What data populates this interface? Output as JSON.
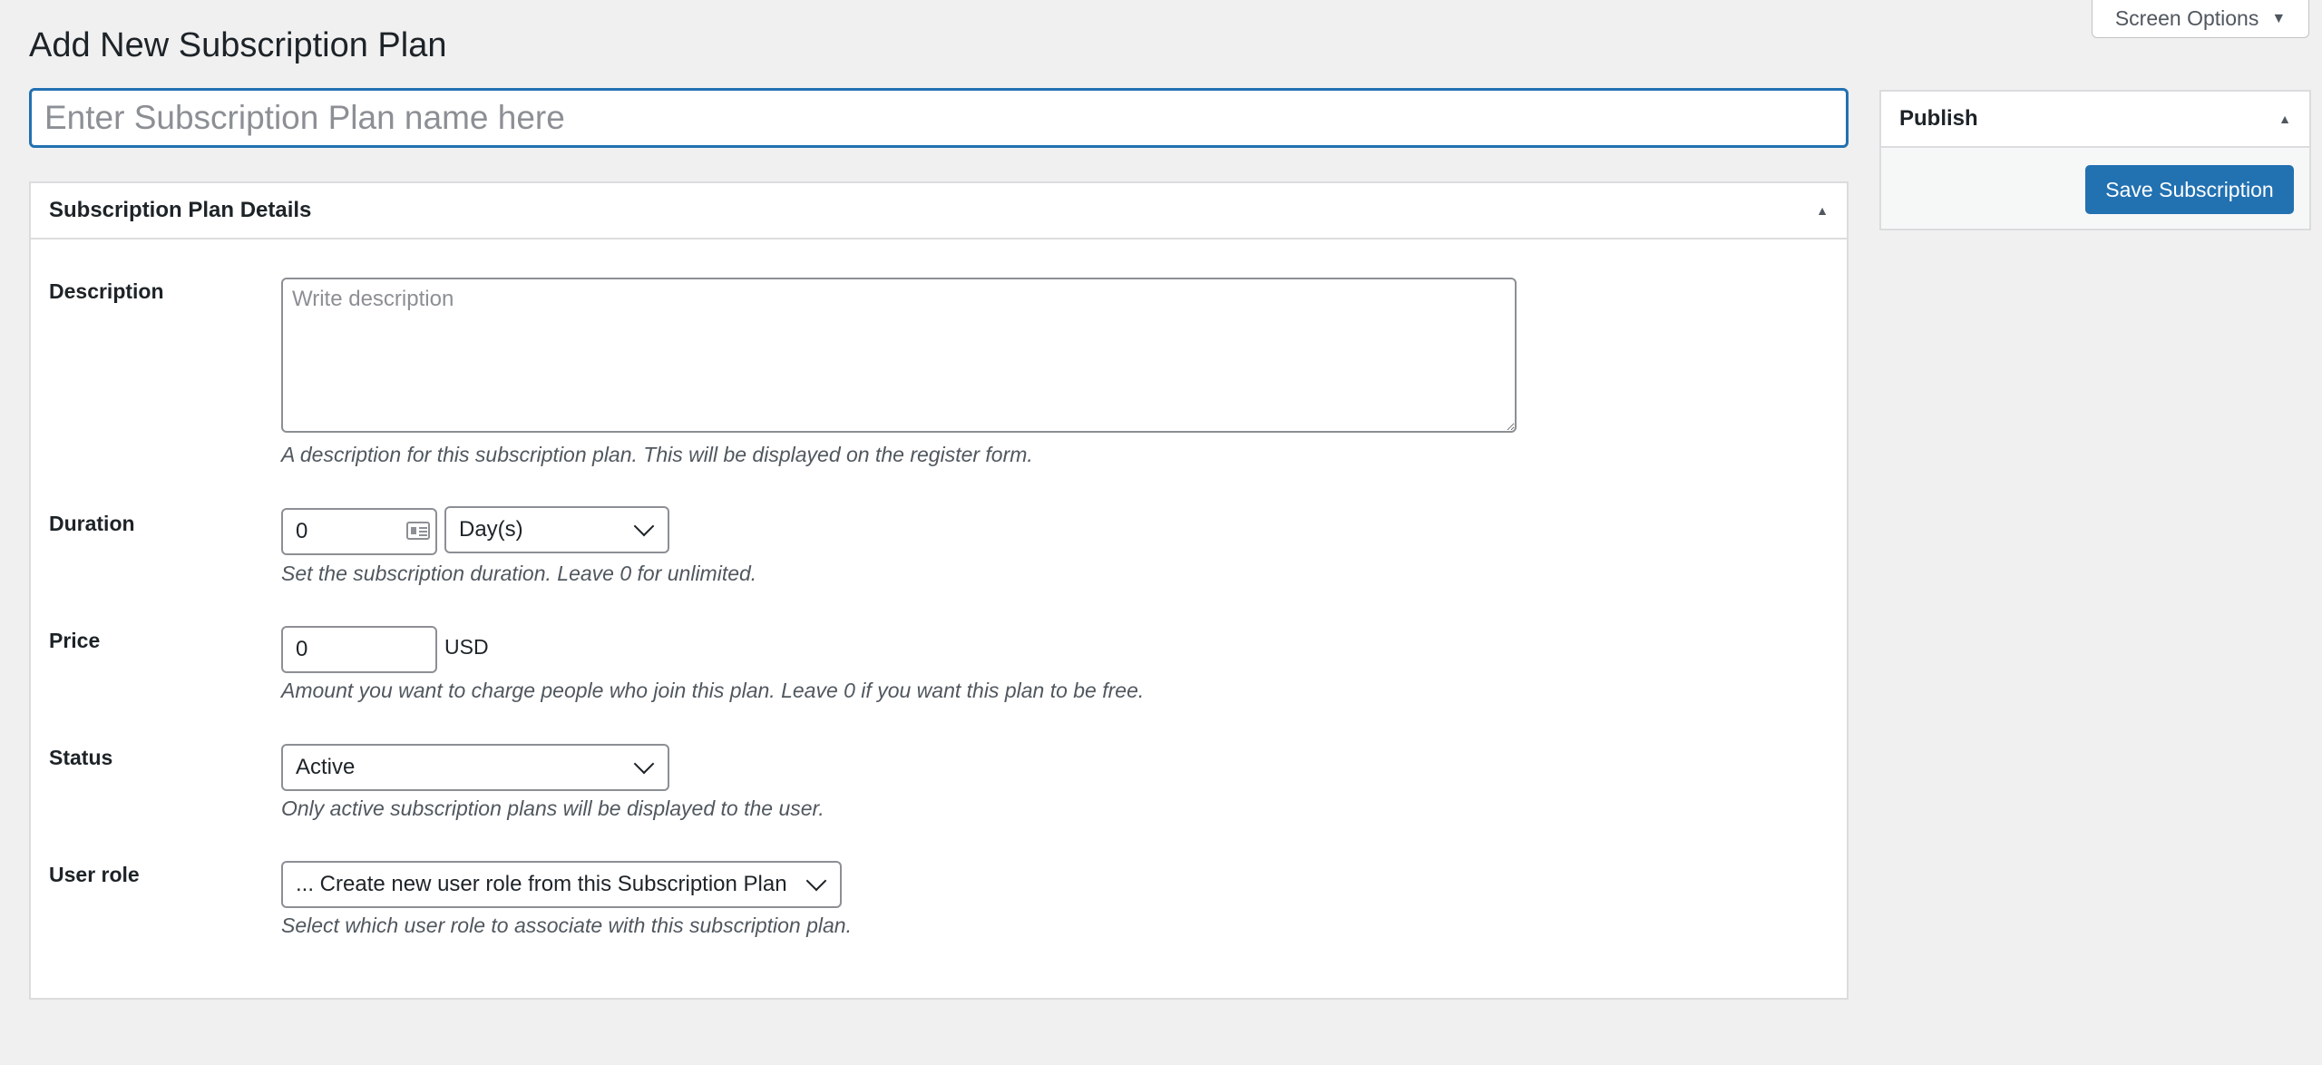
{
  "header": {
    "page_title": "Add New Subscription Plan",
    "screen_options_label": "Screen Options"
  },
  "title_input": {
    "placeholder": "Enter Subscription Plan name here",
    "value": ""
  },
  "details_box": {
    "title": "Subscription Plan Details",
    "description": {
      "label": "Description",
      "placeholder": "Write description",
      "value": "",
      "help": "A description for this subscription plan. This will be displayed on the register form."
    },
    "duration": {
      "label": "Duration",
      "value": "0",
      "unit_selected": "Day(s)",
      "help": "Set the subscription duration. Leave 0 for unlimited."
    },
    "price": {
      "label": "Price",
      "value": "0",
      "currency": "USD",
      "help": "Amount you want to charge people who join this plan. Leave 0 if you want this plan to be free."
    },
    "status": {
      "label": "Status",
      "selected": "Active",
      "help": "Only active subscription plans will be displayed to the user."
    },
    "user_role": {
      "label": "User role",
      "selected": "... Create new user role from this Subscription Plan",
      "help": "Select which user role to associate with this subscription plan."
    }
  },
  "publish_box": {
    "title": "Publish",
    "save_label": "Save Subscription"
  },
  "colors": {
    "primary": "#2271b1",
    "background": "#f0f0f1"
  }
}
